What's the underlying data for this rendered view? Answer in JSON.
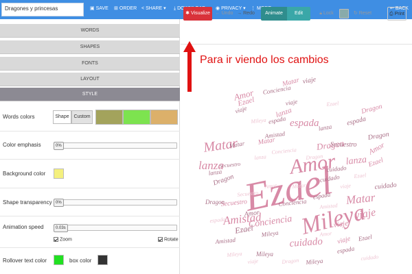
{
  "topbar": {
    "project_name": "Dragones y princesas",
    "save": "SAVE",
    "order": "ORDER",
    "share": "SHARE",
    "download": "DOWNLOAD",
    "privacy": "PRIVACY",
    "more": "MORE",
    "back": "BACK"
  },
  "accordion": {
    "words": "WORDS",
    "shapes": "SHAPES",
    "fonts": "FONTS",
    "layout": "LAYOUT",
    "style": "STYLE"
  },
  "style": {
    "words_colors_label": "Words colors",
    "shape_btn": "Shape",
    "custom_btn": "Custom",
    "word_colors": [
      "#a3a35c",
      "#7de34f",
      "#dcb06a"
    ],
    "color_emphasis_label": "Color emphasis",
    "color_emphasis_value": "0%",
    "background_color_label": "Background color",
    "background_color": "#f4f07e",
    "shape_transparency_label": "Shape transparency",
    "shape_transparency_value": "0%",
    "animation_speed_label": "Animation speed",
    "animation_speed_value": "0.03s",
    "zoom_label": "Zoom",
    "rotate_label": "Rotate",
    "rollover_text_color_label": "Rollover text color",
    "rollover_text_color": "#22e022",
    "box_color_label": "box color",
    "box_color": "#333333"
  },
  "toolbar": {
    "visualize": "Visualize",
    "undo": "Undo",
    "redo": "Redo",
    "animate": "Animate",
    "edit": "Edit",
    "lock": "Lock",
    "reset": "Reset",
    "print": "Print"
  },
  "annotation": {
    "text": "Para ir viendo los cambios"
  },
  "colors": {
    "topbar": "#3f8ee3",
    "visualize": "#d9323a",
    "animate": "#2f8d8d",
    "edit": "#3aa7a8",
    "word_pink": "#d88aa6",
    "word_light": "#eec4d2",
    "word_dark": "#a96e86"
  },
  "cloud": {
    "words": [
      "Amor",
      "Ezael",
      "Mileya",
      "Matar",
      "lanza",
      "viaje",
      "espada",
      "Dragon",
      "Secuestro",
      "Conciencia",
      "Amistad",
      "cuidado",
      "Ezael",
      "Matar",
      "lanza",
      "Secuestro",
      "Dragon",
      "viaje",
      "Amor",
      "Ezael",
      "Conciencia",
      "cuidado",
      "Mileya",
      "espada",
      "Dragon",
      "Amistad",
      "Matar",
      "lanza",
      "viaje",
      "Amor",
      "Ezael",
      "espada",
      "Mileya",
      "Dragon",
      "cuidado",
      "viaje",
      "Amistad",
      "Secuestro",
      "Matar",
      "lanza",
      "Conciencia",
      "Ezael",
      "viaje",
      "espada",
      "Dragon",
      "Amor",
      "Mileya",
      "cuidado",
      "Matar",
      "lanza",
      "viaje",
      "espada",
      "Secuestro",
      "Conciencia",
      "Amistad",
      "Ezael",
      "Mileya",
      "Dragon",
      "Amor",
      "viaje",
      "Matar",
      "espada",
      "lanza",
      "cuidado",
      "Dragon",
      "Amor",
      "viaje",
      "Ezael",
      "Mileya"
    ]
  }
}
